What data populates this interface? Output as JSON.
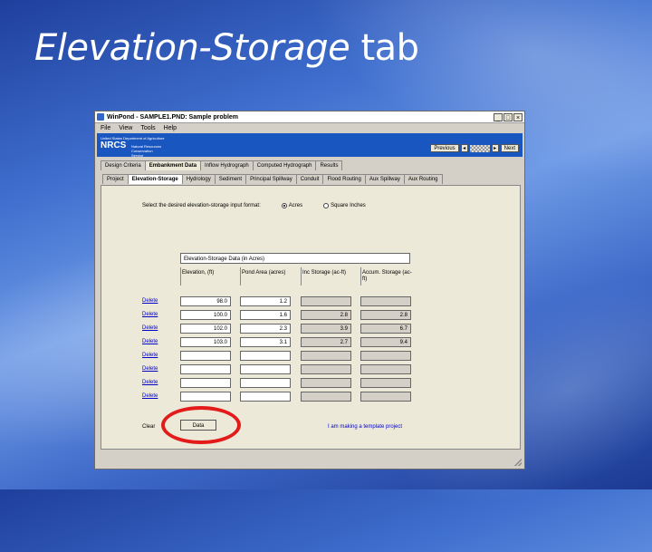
{
  "slide": {
    "title_italic": "Elevation-Storage",
    "title_rest": "tab"
  },
  "window": {
    "title": "WinPond - SAMPLE1.PND: Sample problem",
    "buttons": [
      "_",
      "□",
      "×"
    ],
    "menu": [
      "File",
      "View",
      "Tools",
      "Help"
    ],
    "banner": {
      "agency": "United States Department of Agriculture",
      "logo": "NRCS",
      "service_line1": "Natural Resources",
      "service_line2": "Conservation Service"
    },
    "nav": {
      "previous": "Previous",
      "next": "Next"
    },
    "tabs_top": [
      "Design Criteria",
      "Embankment Data",
      "Inflow Hydrograph",
      "Computed Hydrograph",
      "Results"
    ],
    "active_top": 1,
    "tabs_sub": [
      "Project",
      "Elevation-Storage",
      "Hydrology",
      "Sediment",
      "Principal Spillway",
      "Conduit",
      "Flood Routing",
      "Aux Spillway",
      "Aux Routing"
    ],
    "active_sub": 1,
    "units": {
      "label": "Select the desired elevation-storage input format:",
      "option_acres": "Acres",
      "option_sqin": "Square Inches",
      "selected": "Acres"
    },
    "grid": {
      "title": "Elevation-Storage Data (in Acres)",
      "headers": [
        "Elevation, (ft)",
        "Pond Area (acres)",
        "Inc Storage (ac-ft)",
        "Accum. Storage (ac-ft)"
      ],
      "rows": [
        {
          "delete": "Delete",
          "elevation": "98.0",
          "area": "1.2",
          "inc": "",
          "accum": ""
        },
        {
          "delete": "Delete",
          "elevation": "100.0",
          "area": "1.6",
          "inc": "2.8",
          "accum": "2.8"
        },
        {
          "delete": "Delete",
          "elevation": "102.0",
          "area": "2.3",
          "inc": "3.9",
          "accum": "6.7"
        },
        {
          "delete": "Delete",
          "elevation": "103.0",
          "area": "3.1",
          "inc": "2.7",
          "accum": "9.4"
        },
        {
          "delete": "Delete",
          "elevation": "",
          "area": "",
          "inc": "",
          "accum": ""
        },
        {
          "delete": "Delete",
          "elevation": "",
          "area": "",
          "inc": "",
          "accum": ""
        },
        {
          "delete": "Delete",
          "elevation": "",
          "area": "",
          "inc": "",
          "accum": ""
        },
        {
          "delete": "Delete",
          "elevation": "",
          "area": "",
          "inc": "",
          "accum": ""
        }
      ]
    },
    "clear_label": "Clear",
    "clear_button": "Data",
    "template_link": "I am making a template project"
  }
}
